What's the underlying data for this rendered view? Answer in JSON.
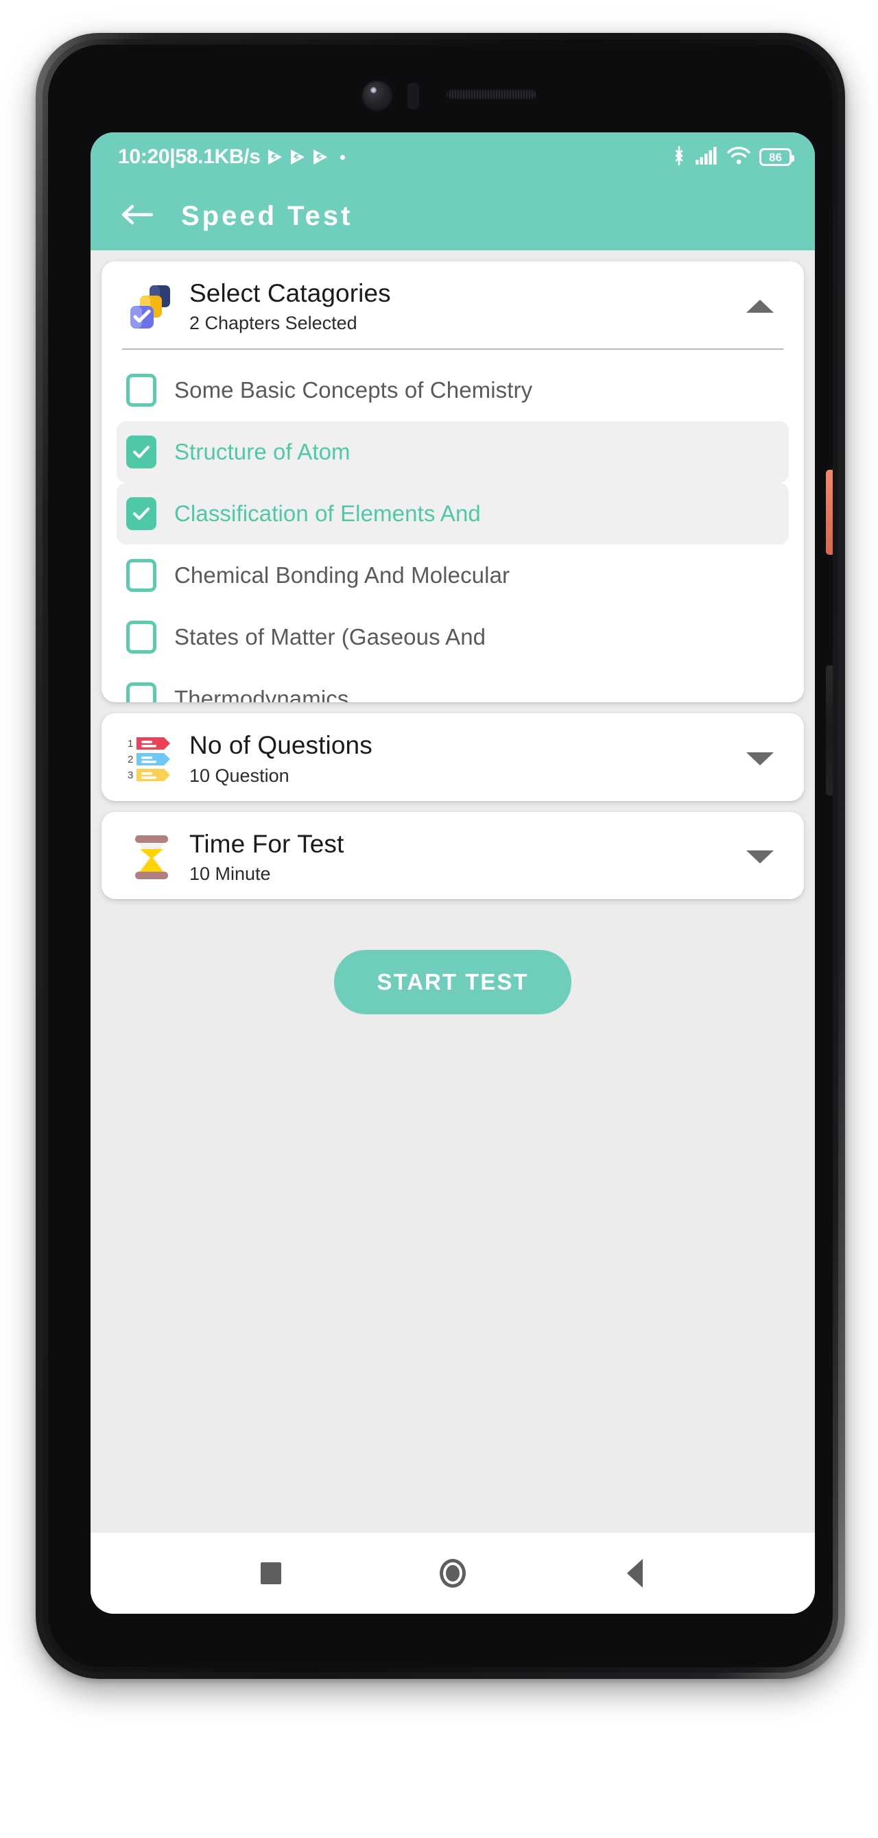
{
  "status_bar": {
    "time": "10:20",
    "separator": "|",
    "network_speed": "58.1KB/s",
    "speed_icons": [
      "play-fast-icon",
      "play-fast-icon",
      "play-fast-icon"
    ],
    "dot": "•",
    "icons": [
      "bluetooth-icon",
      "cellular-signal-icon",
      "wifi-icon"
    ],
    "battery_level": "86",
    "background_color": "#70CFBC",
    "foreground_color": "#FFFFFF"
  },
  "app_bar": {
    "back_icon": "arrow-left-icon",
    "title": "Speed Test",
    "background_color": "#70CFBC"
  },
  "theme": {
    "accent": "#6FCEBB",
    "checkbox_teal": "#4FC8A8",
    "page_background": "#ECECEC",
    "card_background": "#FFFFFF",
    "selected_row_background": "#F0F0F0"
  },
  "cards": {
    "categories": {
      "icon": "stacked-squares-check-icon",
      "title": "Select Catagories",
      "subtitle": "2 Chapters Selected",
      "chevron": "chevron-up-icon",
      "expanded": true,
      "chapters": [
        {
          "label": "Some Basic Concepts of Chemistry",
          "checked": false
        },
        {
          "label": "Structure of Atom",
          "checked": true
        },
        {
          "label": "Classification of Elements And",
          "checked": true
        },
        {
          "label": "Chemical Bonding And Molecular",
          "checked": false
        },
        {
          "label": "States of Matter (Gaseous And",
          "checked": false
        },
        {
          "label": "Thermodynamics",
          "checked": false
        }
      ]
    },
    "questions": {
      "icon": "numbered-list-icon",
      "title": "No of Questions",
      "subtitle": "10 Question",
      "chevron": "chevron-down-icon",
      "expanded": false
    },
    "time": {
      "icon": "hourglass-icon",
      "title": "Time For Test",
      "subtitle": "10 Minute",
      "chevron": "chevron-down-icon",
      "expanded": false
    }
  },
  "start_button": {
    "label": "START TEST"
  },
  "nav_bar": {
    "recents": "square-recents-icon",
    "home": "circle-home-icon",
    "back": "triangle-back-icon"
  }
}
